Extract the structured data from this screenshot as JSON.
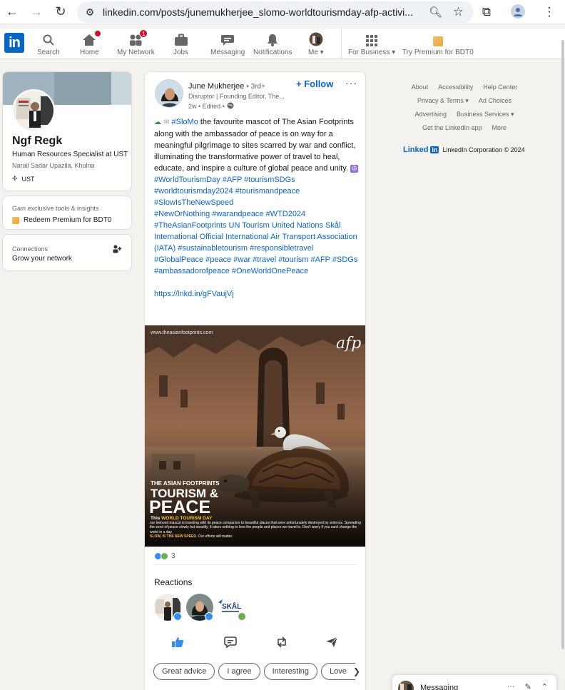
{
  "browser": {
    "url": "linkedin.com/posts/junemukherjee_slomo-worldtourismday-afp-activi..."
  },
  "nav": {
    "items": [
      {
        "label": "Search",
        "icon": "search-icon"
      },
      {
        "label": "Home",
        "icon": "home-icon",
        "badge": ""
      },
      {
        "label": "My Network",
        "icon": "network-icon",
        "badge": "1"
      },
      {
        "label": "Jobs",
        "icon": "briefcase-icon"
      },
      {
        "label": "Messaging",
        "icon": "messaging-icon"
      },
      {
        "label": "Notifications",
        "icon": "bell-icon"
      },
      {
        "label": "Me ▾",
        "icon": "avatar"
      },
      {
        "label": "For Business ▾",
        "icon": "grid-icon"
      },
      {
        "label": "Try Premium for BDT0",
        "icon": "premium-icon"
      }
    ]
  },
  "profile": {
    "name": "Ngf Regk",
    "title": "Human Resources Specialist at UST",
    "location": "Narail Sadar Upazila, Khulna",
    "org": "UST"
  },
  "premium": {
    "subtitle": "Gain exclusive tools & insights",
    "link": "Redeem Premium for BDT0"
  },
  "connections": {
    "label": "Connections",
    "sub": "Grow your network"
  },
  "post": {
    "author": "June Mukherjee",
    "degree": "• 3rd+",
    "headline": "Disruptor | Founding Editor, The...",
    "time": "2w • Edited •",
    "follow_label": "+ Follow",
    "more_label": "···",
    "text_lead": "#SloMo",
    "text_body": " the favourite mascot of The Asian Footprints along with the ambassador of peace is on way for a meaningful pilgrimage to sites scarred by war and conflict, illuminating the transformative power of travel to heal, educate, and inspire a culture of global peace and unity.",
    "hashtags_1": "#WorldTourismDay #AFP #tourismSDGs",
    "hashtags_2": "#worldtourismday2024 #tourismandpeace",
    "hashtags_3": "#SlowIsTheNewSpeed",
    "hashtags_4": "#NewOrNothing #warandpeace #WTD2024",
    "hashtags_5": "#TheAsianFootprints UN Tourism United Nations Skål International Official International Air Transport Association (IATA) #sustainabletourism #responsibletravel #GlobalPeace #peace #war #travel #tourism #AFP #SDGs #ambassadorofpeace #OneWorldOnePeace",
    "link": "https://lnkd.in/gFVaujVj",
    "image": {
      "site": "www.theasianfootprints.com",
      "brand": "afp",
      "kicker": "THE ASIAN FOOTPRINTS",
      "headline_1": "TOURISM &",
      "headline_2": "PEACE",
      "caption_lead": "This ",
      "caption_highlight": "WORLD TOURISM DAY",
      "caption_body": "our beloved mascot is traveling with its peace companion to beautiful places that were unfortunately destroyed by violence. Spreading the word of peace slowly but steadily. It takes nothing to love the people and places we travel to. Don't worry if you can't change the world in a day.",
      "caption_slogan": "SLOW, IS THE NEW SPEED.",
      "caption_tail": " Our efforts will matter."
    },
    "reaction_count": "3",
    "reactions_title": "Reactions",
    "reactor_3_label": "SKÅL",
    "chips": [
      "Great advice",
      "I agree",
      "Interesting",
      "Love"
    ],
    "chip_arrow": "❯"
  },
  "footer": {
    "row1": [
      "About",
      "Accessibility",
      "Help Center"
    ],
    "row2": [
      "Privacy & Terms ▾",
      "Ad Choices"
    ],
    "row3": [
      "Advertising",
      "Business Services ▾"
    ],
    "row4": [
      "Get the LinkedIn app",
      "More"
    ],
    "brand_word": "Linked",
    "brand_box": "in",
    "corp": "LinkedIn Corporation © 2024"
  },
  "messaging": {
    "label": "Messaging",
    "dots": "···"
  },
  "colors": {
    "brand": "#0a66c2",
    "background": "#f4f2ee",
    "badge": "#cb112d"
  }
}
